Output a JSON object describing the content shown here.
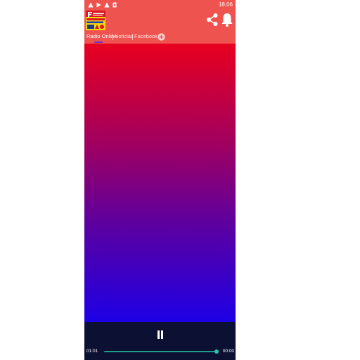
{
  "status_bar": {
    "time": "18:06",
    "icons": [
      "warning-icon",
      "play-store-icon",
      "warning-icon",
      "sd-card-icon"
    ]
  },
  "app_bar": {
    "logo_icon": "station-logo-icon",
    "actions": [
      "share-icon",
      "bell-icon"
    ]
  },
  "tabs": {
    "items": [
      {
        "label": "Radio Online"
      },
      {
        "label": "Noticias"
      },
      {
        "label": "Facebook"
      }
    ],
    "selected_index": 0,
    "add_icon": "plus-circle-icon"
  },
  "player": {
    "elapsed": "01:01",
    "total": "00:00",
    "pause_icon": "pause-icon",
    "progress_fraction": 1.0
  },
  "colors": {
    "app_bar": "#ef5350",
    "tab_indicator": "#6a2fc9",
    "gradient_top": "#e8001f",
    "gradient_bottom": "#1d00e6",
    "controls_bg": "#0c1033",
    "seek": "#26c6b0"
  }
}
